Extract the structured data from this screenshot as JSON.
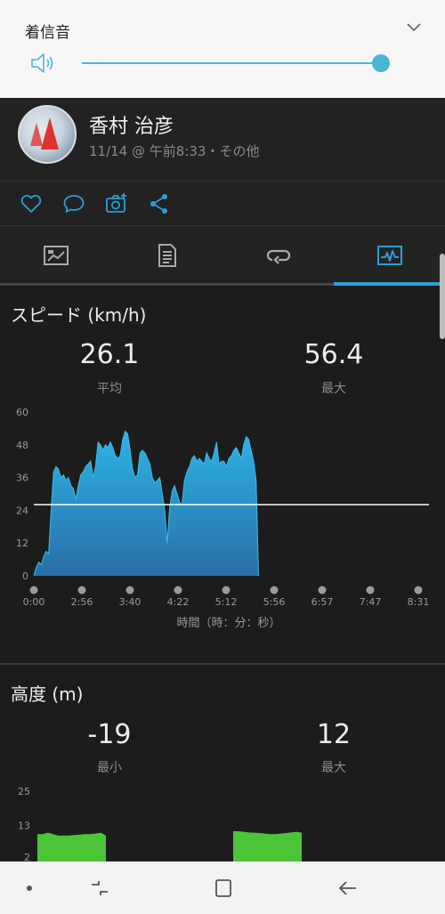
{
  "volume": {
    "title": "着信音",
    "level": 1.0,
    "accent_color": "#49b6d6",
    "icons": [
      "speaker-icon",
      "chevron-down-icon"
    ]
  },
  "activity": {
    "user_name": "香村 治彦",
    "meta": "11/14 @ 午前8:33・その他"
  },
  "actions": [
    "heart-icon",
    "comment-icon",
    "add-photo-icon",
    "share-icon"
  ],
  "tabs": {
    "items": [
      "summary-tab",
      "details-tab",
      "laps-tab",
      "charts-tab"
    ],
    "active_index": 3,
    "accent_color": "#2a9fd6"
  },
  "speed": {
    "title": "スピード (km/h)",
    "avg_value": "26.1",
    "avg_label": "平均",
    "max_value": "56.4",
    "max_label": "最大",
    "axis_caption": "時間（時：分：秒）"
  },
  "elevation": {
    "title": "高度 (m)",
    "min_value": "-19",
    "min_label": "最小",
    "max_value": "12",
    "max_label": "最大"
  },
  "chart_data": [
    {
      "type": "area",
      "title": "スピード (km/h)",
      "xlabel": "時間（時：分：秒）",
      "ylabel": "",
      "ylim": [
        0,
        60
      ],
      "yticks": [
        "60",
        "48",
        "36",
        "24",
        "12",
        "0"
      ],
      "xticks": [
        "0:00",
        "2:56",
        "3:40",
        "4:22",
        "5:12",
        "5:56",
        "6:57",
        "7:47",
        "8:31"
      ],
      "reference_line": 26.1,
      "fill_color": "#29a3d9",
      "x": [
        0,
        0.5,
        1,
        1.5,
        2,
        2.5,
        3,
        3.5,
        4,
        4.5,
        5,
        5.5,
        6,
        6.5,
        7,
        7.5,
        8,
        8.5,
        9,
        9.5,
        10,
        10.5,
        11,
        11.5,
        12,
        12.5,
        13,
        13.5,
        14,
        14.5,
        15,
        15.5,
        16,
        16.5,
        17,
        17.5,
        18,
        18.5,
        19,
        19.5,
        20,
        20.5,
        21,
        21.5,
        22,
        22.5,
        23,
        23.5,
        24,
        24.5,
        25,
        25.5,
        26,
        26.5,
        27,
        27.5,
        28,
        28.5,
        29,
        29.5,
        30,
        30.5,
        31,
        31.5,
        32,
        32.5,
        33,
        33.5,
        34,
        34.5,
        35,
        35.5,
        36,
        36.5,
        37,
        37.5,
        38,
        38.5,
        39,
        39.5,
        40,
        40.5,
        41,
        41.5,
        42,
        42.5,
        43,
        43.5,
        44,
        44.5,
        45,
        45.5,
        46,
        46.5,
        47,
        47.5,
        48,
        48.5,
        49,
        49.5,
        50,
        50.5,
        51,
        51.5,
        52,
        52.5,
        53,
        53.5,
        54,
        54.5,
        55,
        55.5,
        56,
        56.5,
        57,
        57.5,
        58,
        58.5,
        59,
        59.5,
        60,
        60.5,
        61,
        61.5,
        62,
        62.5,
        63,
        63.5,
        64,
        64.5,
        65,
        65.5,
        66,
        66.5,
        67,
        67.5,
        68,
        68.5,
        69,
        69.5,
        70,
        70.5,
        71,
        71.5,
        72,
        72.5,
        73,
        73.5,
        74,
        74.5,
        75,
        75.5,
        76,
        76.5,
        77,
        77.5,
        78,
        78.5,
        79,
        79.5,
        80
      ],
      "values": [
        0,
        3,
        5,
        4,
        7,
        9,
        8,
        24,
        38,
        40,
        39,
        36,
        37,
        35,
        36,
        33,
        32,
        28,
        33,
        37,
        38,
        40,
        41,
        42,
        36,
        40,
        49,
        48,
        46,
        48,
        47,
        49,
        47,
        44,
        43,
        44,
        50,
        53,
        52,
        46,
        39,
        36,
        37,
        45,
        46,
        45,
        43,
        41,
        36,
        34,
        35,
        36,
        30,
        24,
        12,
        25,
        31,
        33,
        30,
        27,
        26,
        35,
        38,
        40,
        43,
        44,
        42,
        43,
        42,
        41,
        45,
        43,
        42,
        45,
        49,
        41,
        42,
        42,
        40,
        43,
        44,
        46,
        47,
        45,
        43,
        48,
        51,
        50,
        46,
        42,
        35,
        0
      ],
      "x_note": "minutes-estimated-positions"
    },
    {
      "type": "area",
      "title": "高度 (m)",
      "ylim": [
        2,
        25
      ],
      "yticks": [
        "25",
        "13",
        "2"
      ],
      "fill_color": "#4cc437",
      "segments": [
        {
          "start": 0,
          "end": 14,
          "values": [
            10,
            10,
            10.5,
            10,
            9.5,
            9.5,
            9.5,
            9.7,
            9.8,
            10,
            10,
            10.2,
            10.5,
            9.5
          ]
        },
        {
          "start": 40,
          "end": 54,
          "values": [
            11,
            11,
            10.8,
            10.6,
            10.5,
            10.4,
            10.2,
            10,
            10,
            10.2,
            10.4,
            10.6,
            10.8,
            10.5
          ]
        }
      ]
    }
  ]
}
